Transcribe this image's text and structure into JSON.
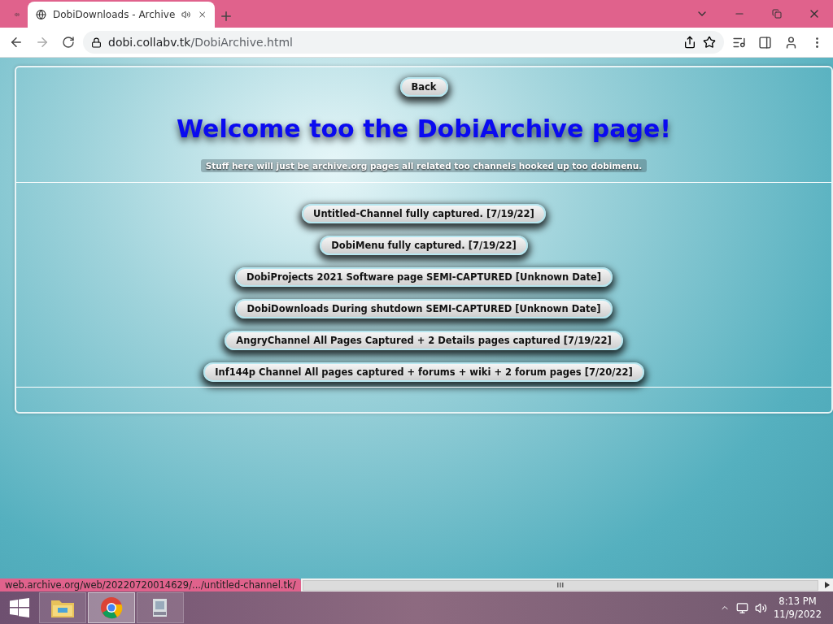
{
  "tabs": [
    {
      "selected": false,
      "audio": true
    },
    {
      "title": "DobiDownloads - Archive",
      "selected": true,
      "audio": true
    }
  ],
  "address": {
    "host": "dobi.collabv.tk",
    "path": "/DobiArchive.html"
  },
  "page": {
    "back_button": "Back",
    "heading": "Welcome too the DobiArchive page!",
    "subtitle": "Stuff here will just be archive.org pages all related too channels hooked up too dobimenu.",
    "links": [
      "Untitled-Channel fully captured. [7/19/22]",
      "DobiMenu fully captured. [7/19/22]",
      "DobiProjects 2021 Software page SEMI-CAPTURED [Unknown Date]",
      "DobiDownloads During shutdown SEMI-CAPTURED [Unknown Date]",
      "AngryChannel All Pages Captured + 2 Details pages captured [7/19/22]",
      "Inf144p Channel All pages captured + forums + wiki + 2 forum pages [7/20/22]"
    ]
  },
  "status_bar": {
    "url": "web.archive.org/web/20220720014629/.../untitled-channel.tk/"
  },
  "taskbar": {
    "apps": [
      {
        "kind": "folder",
        "selected": false
      },
      {
        "kind": "chrome",
        "selected": true
      },
      {
        "kind": "installer",
        "selected": false
      }
    ],
    "time": "8:13 PM",
    "date": "11/9/2022"
  }
}
